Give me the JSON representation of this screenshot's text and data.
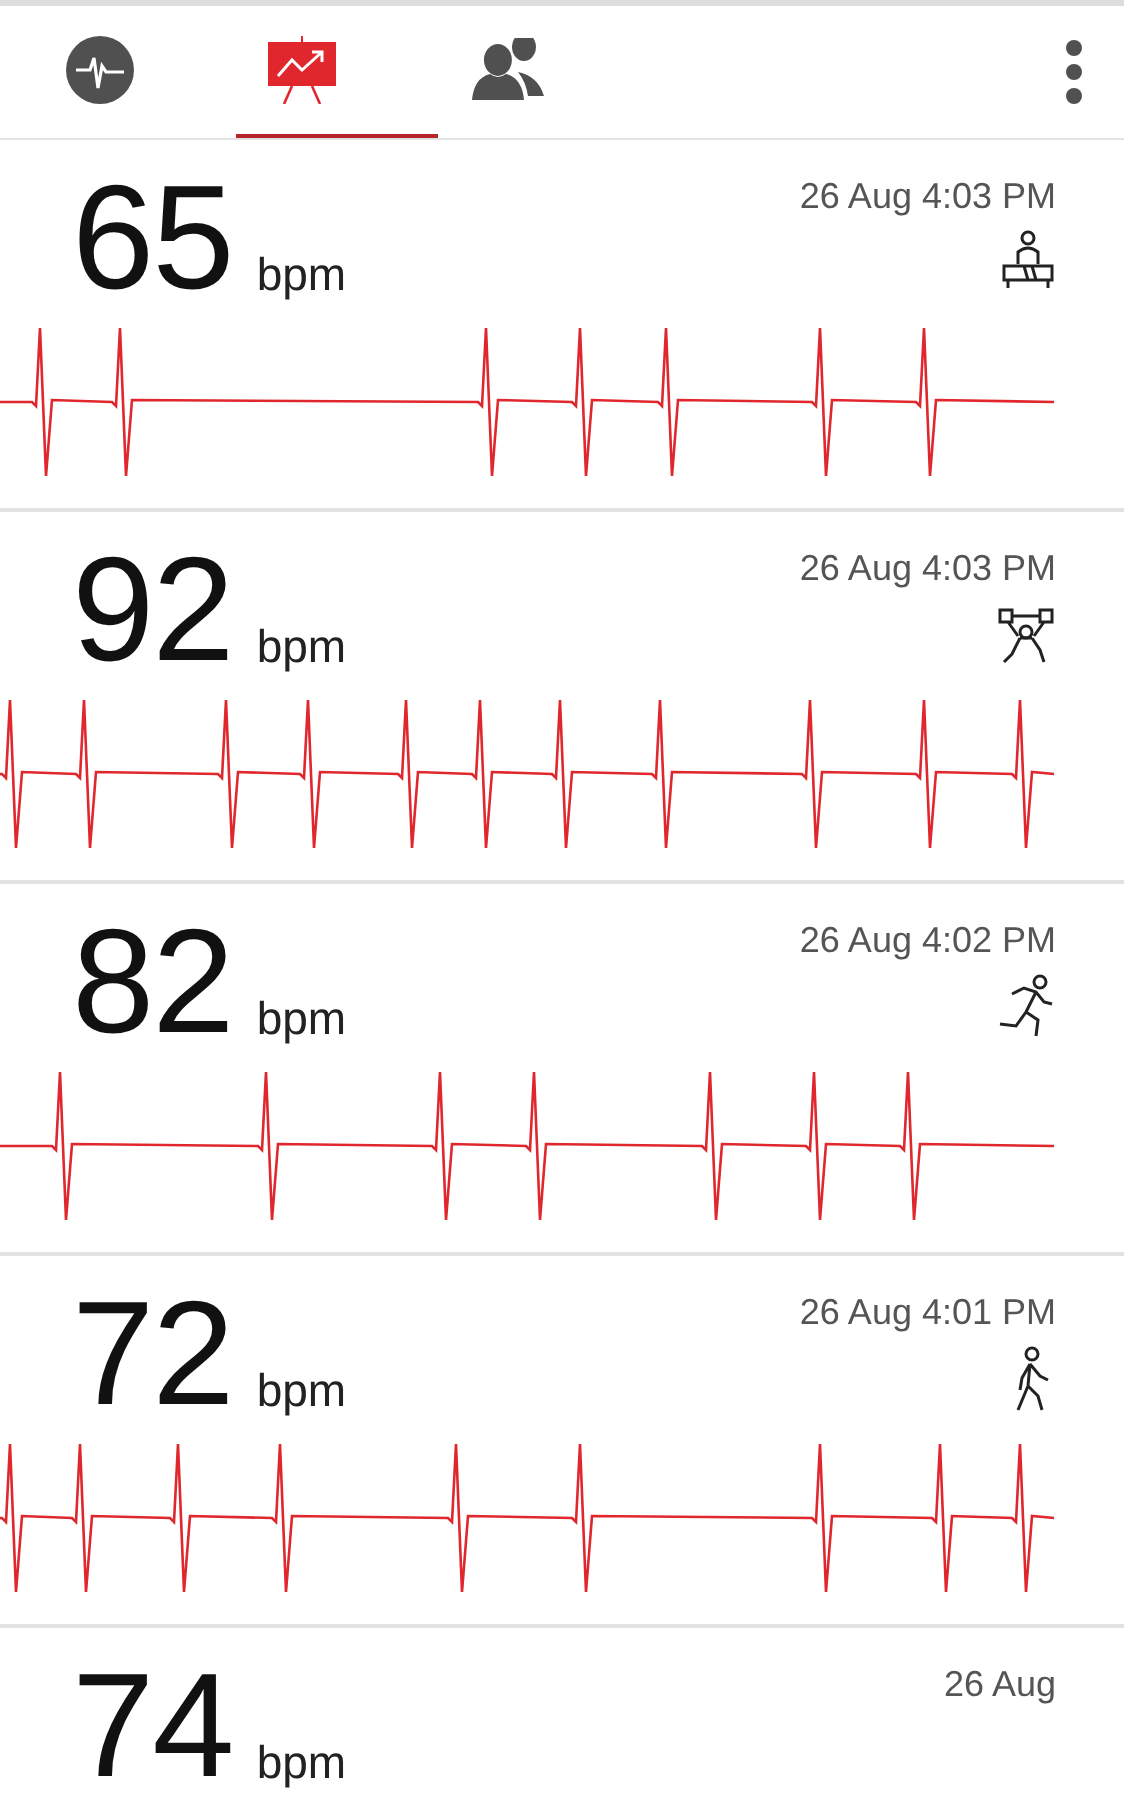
{
  "tabs": [
    {
      "kind": "pulse",
      "selected": false
    },
    {
      "kind": "history",
      "selected": true
    },
    {
      "kind": "people",
      "selected": false
    }
  ],
  "readings": [
    {
      "value": "65",
      "unit": "bpm",
      "time": "26 Aug 4:03 PM",
      "kind": "resting"
    },
    {
      "value": "92",
      "unit": "bpm",
      "time": "26 Aug 4:03 PM",
      "kind": "lifting"
    },
    {
      "value": "82",
      "unit": "bpm",
      "time": "26 Aug 4:02 PM",
      "kind": "running"
    },
    {
      "value": "72",
      "unit": "bpm",
      "time": "26 Aug 4:01 PM",
      "kind": "walking"
    },
    {
      "value": "74",
      "unit": "bpm",
      "time": "26 Aug"
    }
  ]
}
